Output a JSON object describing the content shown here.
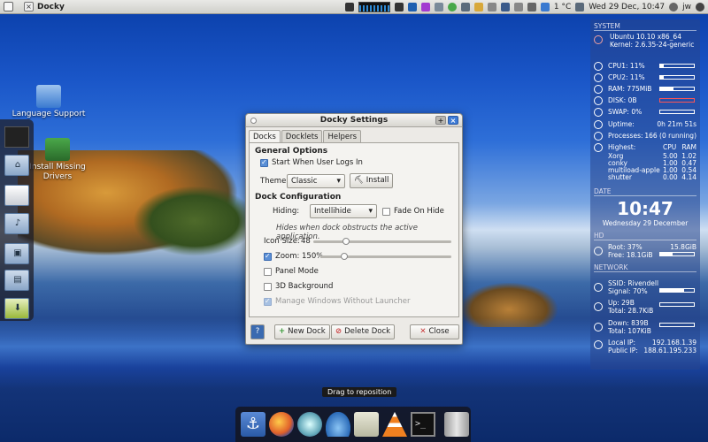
{
  "top_panel": {
    "app_title": "Docky",
    "clock": "Wed 29 Dec, 10:47",
    "temperature": "1 °C",
    "user": "jw"
  },
  "desktop_icons": [
    {
      "label": "Language Support"
    },
    {
      "label": "Install Missing Drivers"
    }
  ],
  "dialog": {
    "title": "Docky Settings",
    "tabs": [
      "Docks",
      "Docklets",
      "Helpers"
    ],
    "general_options_heading": "General Options",
    "start_when_logs_in": "Start When User Logs In",
    "theme_label": "Theme:",
    "theme_value": "Classic",
    "install_button": "Install",
    "dock_configuration_heading": "Dock Configuration",
    "hiding_label": "Hiding:",
    "hiding_value": "Intellihide",
    "fade_on_hide": "Fade On Hide",
    "hiding_hint": "Hides when dock obstructs the active application.",
    "icon_size_label": "Icon Size:",
    "icon_size_value": "48",
    "zoom_label": "Zoom:",
    "zoom_value": "150%",
    "panel_mode": "Panel Mode",
    "background_3d": "3D Background",
    "manage_windows": "Manage Windows Without Launcher",
    "new_dock_button": "New Dock",
    "delete_dock_button": "Delete Dock",
    "close_button": "Close",
    "icon_size_fraction": 0.24,
    "zoom_fraction": 0.18
  },
  "conky": {
    "system_heading": "SYSTEM",
    "os": "Ubuntu 10.10 x86_64",
    "kernel": "Kernel: 2.6.35-24-generic",
    "cpu1": "CPU1: 11%",
    "cpu2": "CPU2: 11%",
    "ram": "RAM: 775MiB",
    "disk": "DISK: 0B",
    "swap": "SWAP: 0%",
    "uptime_label": "Uptime:",
    "uptime_value": "0h 21m 51s",
    "processes_label": "Processes:",
    "processes_value": "166 (0 running)",
    "highest_label": "Highest:",
    "col_cpu": "CPU",
    "col_ram": "RAM",
    "procs": [
      {
        "name": "Xorg",
        "cpu": "5.00",
        "ram": "1.02"
      },
      {
        "name": "conky",
        "cpu": "1.00",
        "ram": "0.47"
      },
      {
        "name": "multiload-apple",
        "cpu": "1.00",
        "ram": "0.54"
      },
      {
        "name": "shutter",
        "cpu": "0.00",
        "ram": "4.14"
      }
    ],
    "date_heading": "DATE",
    "time": "10:47",
    "date": "Wednesday 29 December",
    "hd_heading": "HD",
    "root": "Root: 37%",
    "root_size": "15.8GiB",
    "free": "Free: 18.1GiB",
    "network_heading": "NETWORK",
    "ssid": "SSID: Rivendell",
    "signal": "Signal: 70%",
    "up": "Up: 29B",
    "up_total": "Total: 28.7KiB",
    "down": "Down: 839B",
    "down_total": "Total: 107KiB",
    "local_ip_label": "Local IP:",
    "local_ip": "192.168.1.39",
    "public_ip_label": "Public IP:",
    "public_ip": "188.61.195.233",
    "cpu1_fraction": 0.11,
    "cpu2_fraction": 0.11,
    "ram_fraction": 0.4,
    "swap_fraction": 0.0,
    "root_fraction": 0.37,
    "signal_fraction": 0.7
  },
  "tooltip": "Drag to reposition",
  "bottom_dock_items": [
    "anchor-icon",
    "firefox-icon",
    "weather-icon",
    "droplet-icon",
    "speaker-icon",
    "vlc-cone-icon",
    "terminal-icon",
    "trash-icon"
  ]
}
